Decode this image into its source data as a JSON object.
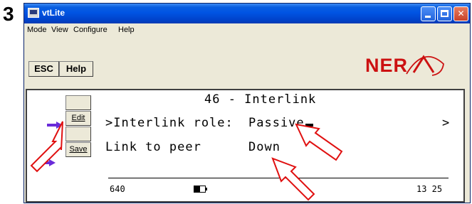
{
  "step": "3",
  "window": {
    "title": "vtLite",
    "menu": [
      "Mode",
      "View",
      "Configure",
      "Help"
    ]
  },
  "toolbar": {
    "esc_label": "ESC",
    "help_label": "Help",
    "logo": "NERA"
  },
  "panel": {
    "side_buttons": [
      {
        "label": ""
      },
      {
        "label": "Edit"
      },
      {
        "label": ""
      },
      {
        "label": "Save"
      }
    ],
    "screen": {
      "header": "46 - Interlink",
      "row1_label": ">Interlink role:",
      "row1_value": "Passive",
      "row1_nav": ">",
      "row2_label": "Link to peer",
      "row2_value": "Down",
      "footer_left": "640",
      "footer_right": "13 25",
      "signal_level": 0.55
    }
  },
  "colors": {
    "titlebar": "#0054e3",
    "window_bg": "#ece9d8",
    "logo_red": "#cc1111",
    "arrow_purple": "#6a2bd9",
    "callout_red": "#e01010"
  },
  "icons": [
    "app-icon",
    "minimize-icon",
    "maximize-icon",
    "close-icon",
    "arrow-right-icon",
    "pointer-arrow-icon",
    "battery-icon"
  ]
}
